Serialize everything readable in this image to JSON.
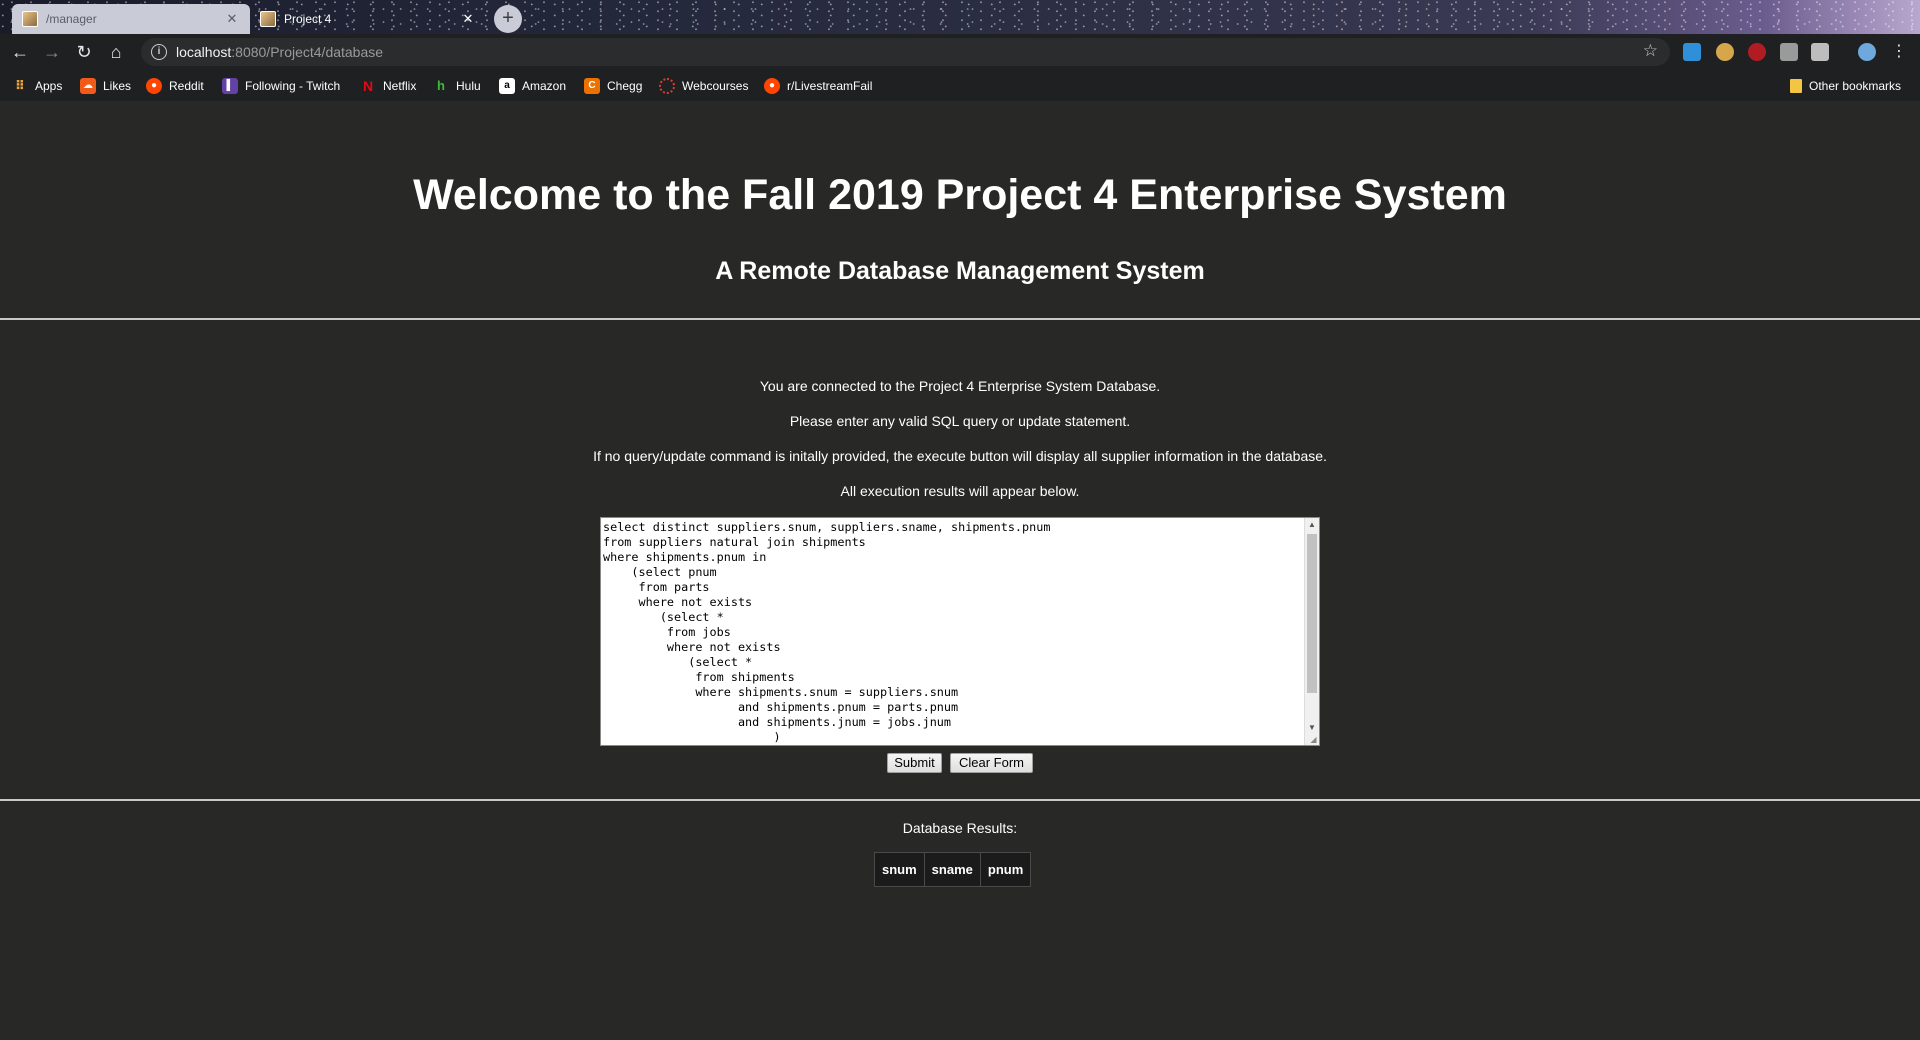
{
  "browser": {
    "tabs": [
      {
        "title": "/manager",
        "active": false
      },
      {
        "title": "Project 4",
        "active": true
      }
    ],
    "url_host": "localhost",
    "url_path": ":8080/Project4/database",
    "bookmarks": [
      {
        "label": "Apps",
        "icon": "apps-grid-icon"
      },
      {
        "label": "Likes",
        "icon": "soundcloud-icon"
      },
      {
        "label": "Reddit",
        "icon": "reddit-icon"
      },
      {
        "label": "Following - Twitch",
        "icon": "twitch-icon"
      },
      {
        "label": "Netflix",
        "icon": "netflix-icon"
      },
      {
        "label": "Hulu",
        "icon": "hulu-icon"
      },
      {
        "label": "Amazon",
        "icon": "amazon-icon"
      },
      {
        "label": "Chegg",
        "icon": "chegg-icon"
      },
      {
        "label": "Webcourses",
        "icon": "webcourses-icon"
      },
      {
        "label": "r/LivestreamFail",
        "icon": "reddit-icon"
      }
    ],
    "other_bookmarks": "Other bookmarks"
  },
  "page": {
    "title": "Welcome to the Fall 2019 Project 4 Enterprise System",
    "subtitle": "A Remote Database Management System",
    "messages": [
      "You are connected to the Project 4 Enterprise System Database.",
      "Please enter any valid SQL query or update statement.",
      "If no query/update command is initally provided, the execute button will display all supplier information in the database.",
      "All execution results will appear below."
    ],
    "sql_text": "select distinct suppliers.snum, suppliers.sname, shipments.pnum\nfrom suppliers natural join shipments\nwhere shipments.pnum in\n    (select pnum\n     from parts\n     where not exists\n        (select *\n         from jobs\n         where not exists\n            (select *\n             from shipments\n             where shipments.snum = suppliers.snum\n                   and shipments.pnum = parts.pnum\n                   and shipments.jnum = jobs.jnum\n                        )",
    "submit_label": "Submit",
    "clear_label": "Clear Form",
    "results_label": "Database Results:",
    "results_columns": [
      "snum",
      "sname",
      "pnum"
    ]
  },
  "colors": {
    "page_background": "#282927",
    "browser_chrome": "#1f2021"
  }
}
